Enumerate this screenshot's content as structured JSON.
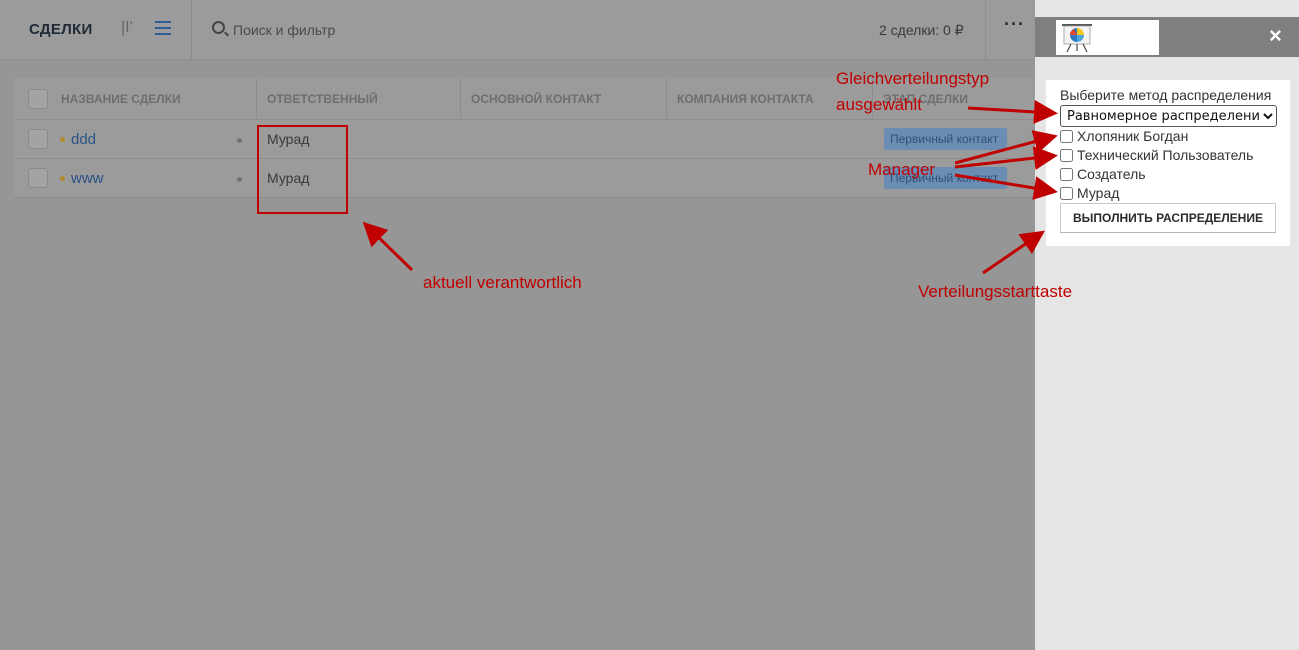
{
  "header": {
    "title": "СДЕЛКИ",
    "view_pipeline_icon": "|I'",
    "search_placeholder": "Поиск и фильтр",
    "summary": "2 сделки: 0 ₽",
    "more_label": "···"
  },
  "table": {
    "columns": [
      "НАЗВАНИЕ СДЕЛКИ",
      "ОТВЕТСТВЕННЫЙ",
      "ОСНОВНОЙ КОНТАКТ",
      "КОМПАНИЯ КОНТАКТА",
      "ЭТАП СДЕЛКИ"
    ],
    "rows": [
      {
        "name": "ddd",
        "responsible": "Мурад",
        "stage": "Первичный контакт"
      },
      {
        "name": "www",
        "responsible": "Мурад",
        "stage": "Первичный контакт"
      }
    ]
  },
  "panel": {
    "close_label": "×",
    "form_label": "Выберите метод распределения",
    "method_selected": "Равномерное распределение",
    "managers": [
      "Хлопяник Богдан",
      "Технический Пользователь",
      "Создатель",
      "Мурад"
    ],
    "run_button": "ВЫПОЛНИТЬ РАСПРЕДЕЛЕНИЕ"
  },
  "annotations": {
    "type_selected_line1": "Gleichverteilungstyp",
    "type_selected_line2": "ausgewählt",
    "managers": "Manager",
    "start_button": "Verteilungsstarttaste",
    "current_responsible": "aktuell verantwortlich"
  },
  "colors": {
    "annotation": "#c00000",
    "overlay": "#969696",
    "link": "#2a5187",
    "stage_badge": "#6b8db3"
  }
}
